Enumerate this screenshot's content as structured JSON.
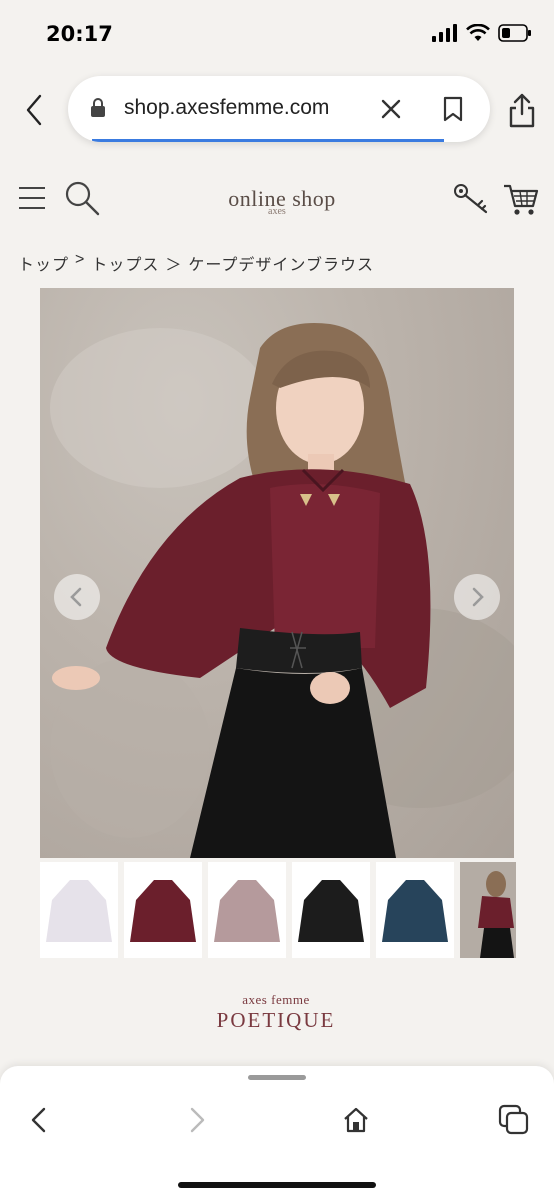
{
  "status_bar": {
    "time": "20:17",
    "battery_level": 0.3,
    "icons": [
      "signal-icon",
      "wifi-icon",
      "battery-icon"
    ]
  },
  "browser": {
    "url": "shop.axesfemme.com",
    "accent_color": "#3a7be0",
    "icons": [
      "back-icon",
      "lock-icon",
      "close-icon",
      "bookmark-icon",
      "share-icon"
    ]
  },
  "header": {
    "logo_text": "online shop",
    "logo_sub": "axes",
    "icons": [
      "menu-icon",
      "search-icon",
      "key-icon",
      "cart-icon"
    ]
  },
  "breadcrumb": {
    "items": [
      "トップ",
      ">",
      "トップス",
      "＞",
      "ケープデザインブラウス"
    ]
  },
  "product": {
    "thumbnail_colors": [
      "#e6e2ea",
      "#6b1f2c",
      "#b59a9c",
      "#1c1c1c",
      "#27445b"
    ]
  },
  "brand": {
    "top": "axes femme",
    "main": "POETIQUE"
  },
  "toolbar": {
    "icons": [
      "back-icon",
      "forward-icon",
      "home-icon",
      "tabs-icon"
    ]
  }
}
